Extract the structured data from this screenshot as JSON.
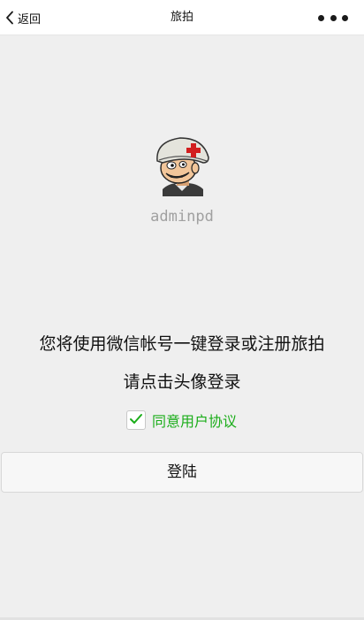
{
  "nav": {
    "back_label": "返回",
    "title": "旅拍"
  },
  "profile": {
    "username": "adminpd"
  },
  "main": {
    "notice_line1": "您将使用微信帐号一键登录或注册旅拍",
    "notice_line2": "请点击头像登录",
    "agree_label": "同意用户协议",
    "agree_checked": true,
    "login_label": "登陆"
  },
  "colors": {
    "accent_green": "#1aad19",
    "background": "#efefef",
    "username_gray": "#a0a0a0"
  },
  "icons": {
    "back": "chevron-left-icon",
    "more": "more-horizontal-icon",
    "check": "check-icon",
    "avatar": "soldier-helmet-avatar"
  }
}
